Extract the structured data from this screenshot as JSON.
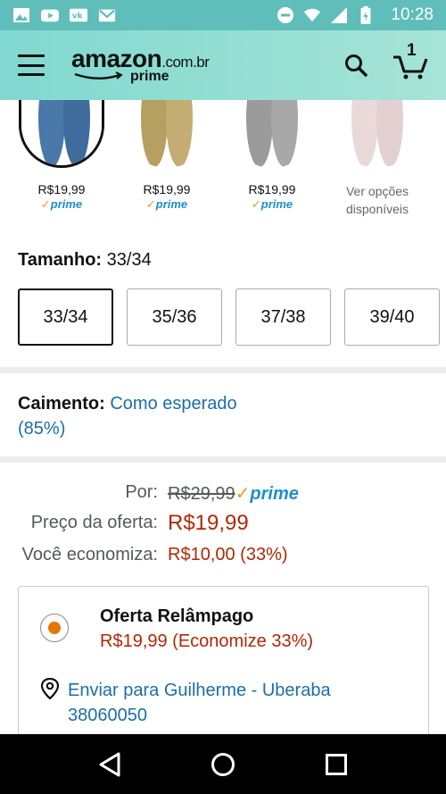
{
  "status_bar": {
    "time": "10:28",
    "left_icons": [
      "image-icon",
      "youtube-icon",
      "vk-icon",
      "gmail-icon"
    ],
    "right_icons": [
      "do-not-disturb-icon",
      "wifi-icon",
      "signal-icon",
      "battery-icon"
    ]
  },
  "header": {
    "logo_main": "amazon",
    "logo_tld": ".com.br",
    "logo_sub": "prime",
    "cart_count": "1"
  },
  "swatches": [
    {
      "price": "R$19,99",
      "prime": "prime",
      "color": "#4a78a8",
      "selected": true
    },
    {
      "price": "R$19,99",
      "prime": "prime",
      "color": "#b79f62",
      "selected": false
    },
    {
      "price": "R$19,99",
      "prime": "prime",
      "color": "#9b9b9b",
      "selected": false
    },
    {
      "more": "Ver opções disponíveis",
      "color": "#e8d6d6",
      "selected": false
    }
  ],
  "size": {
    "label": "Tamanho:",
    "value": "33/34",
    "options": [
      "33/34",
      "35/36",
      "37/38",
      "39/40"
    ],
    "selected": "33/34"
  },
  "fit": {
    "label": "Caimento:",
    "value": "Como esperado (85%)"
  },
  "pricing": {
    "por_label": "Por:",
    "por_value": "R$29,99",
    "prime": "prime",
    "offer_label": "Preço da oferta:",
    "offer_value": "R$19,99",
    "save_label": "Você economiza:",
    "save_value": "R$10,00 (33%)"
  },
  "offer": {
    "title": "Oferta Relâmpago",
    "subtitle": "R$19,99 (Economize 33%)",
    "ship_to": "Enviar para Guilherme - Uberaba 38060050"
  },
  "colors": {
    "header_bg": "#80d8d0",
    "status_bg": "#5fbeb9",
    "price_red": "#b12704",
    "link_blue": "#1a6fa8",
    "prime_blue": "#1d8fc9",
    "radio_orange": "#e77600"
  }
}
